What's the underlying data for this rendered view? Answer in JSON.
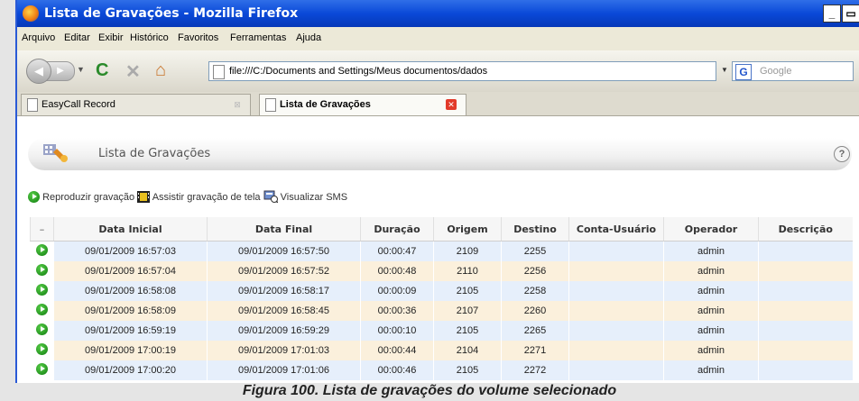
{
  "window": {
    "title": "Lista de Gravações - Mozilla Firefox"
  },
  "menu": [
    "Arquivo",
    "Editar",
    "Exibir",
    "Histórico",
    "Favoritos",
    "Ferramentas",
    "Ajuda"
  ],
  "nav": {
    "url": "file:///C:/Documents and Settings/Meus documentos/dados",
    "search_placeholder": "Google"
  },
  "tabs": [
    {
      "label": "EasyCall Record"
    },
    {
      "label": "Lista de Gravações"
    }
  ],
  "page": {
    "title": "Lista de Gravações",
    "help": "?"
  },
  "actions": {
    "play": "Reproduzir gravação",
    "screen": "Assistir gravação de tela",
    "sms": "Visualizar SMS"
  },
  "table": {
    "columns": [
      "–",
      "Data Inicial",
      "Data Final",
      "Duração",
      "Origem",
      "Destino",
      "Conta-Usuário",
      "Operador",
      "Descrição"
    ],
    "rows": [
      [
        "09/01/2009 16:57:03",
        "09/01/2009 16:57:50",
        "00:00:47",
        "2109",
        "2255",
        "",
        "admin",
        ""
      ],
      [
        "09/01/2009 16:57:04",
        "09/01/2009 16:57:52",
        "00:00:48",
        "2110",
        "2256",
        "",
        "admin",
        ""
      ],
      [
        "09/01/2009 16:58:08",
        "09/01/2009 16:58:17",
        "00:00:09",
        "2105",
        "2258",
        "",
        "admin",
        ""
      ],
      [
        "09/01/2009 16:58:09",
        "09/01/2009 16:58:45",
        "00:00:36",
        "2107",
        "2260",
        "",
        "admin",
        ""
      ],
      [
        "09/01/2009 16:59:19",
        "09/01/2009 16:59:29",
        "00:00:10",
        "2105",
        "2265",
        "",
        "admin",
        ""
      ],
      [
        "09/01/2009 17:00:19",
        "09/01/2009 17:01:03",
        "00:00:44",
        "2104",
        "2271",
        "",
        "admin",
        ""
      ],
      [
        "09/01/2009 17:00:20",
        "09/01/2009 17:01:06",
        "00:00:46",
        "2105",
        "2272",
        "",
        "admin",
        ""
      ]
    ]
  },
  "caption": "Figura 100. Lista de gravações do volume selecionado"
}
